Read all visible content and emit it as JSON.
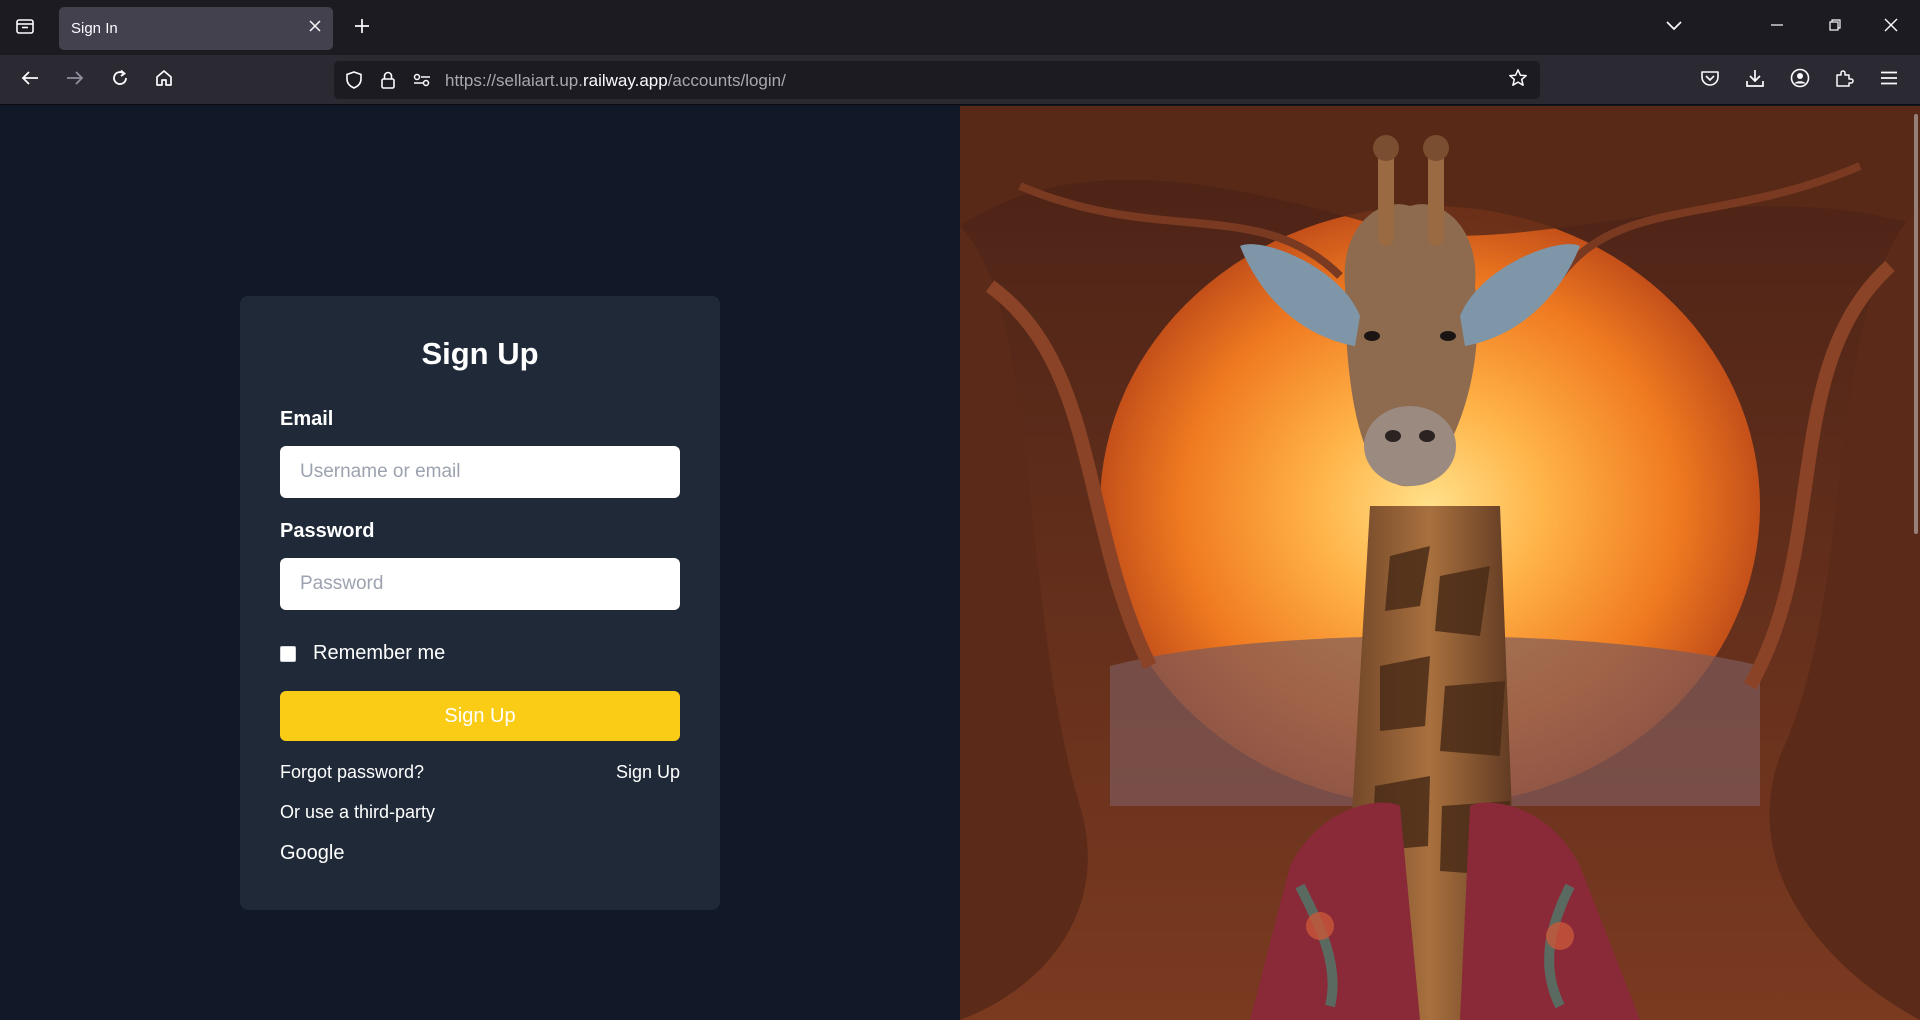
{
  "browser": {
    "tab_title": "Sign In",
    "url_prefix": "https://sellaiart.up.",
    "url_host": "railway.app",
    "url_path": "/accounts/login/"
  },
  "form": {
    "title": "Sign Up",
    "email_label": "Email",
    "email_placeholder": "Username or email",
    "email_value": "",
    "password_label": "Password",
    "password_placeholder": "Password",
    "password_value": "",
    "remember_label": "Remember me",
    "remember_checked": false,
    "submit_label": "Sign Up",
    "forgot_link": "Forgot password?",
    "signup_link": "Sign Up",
    "third_party_text": "Or use a third-party",
    "google_link": "Google"
  },
  "colors": {
    "page_bg": "#111827",
    "card_bg": "#1f2937",
    "accent": "#facc15"
  },
  "icons": [
    "tab-list-icon",
    "close-icon",
    "plus-icon",
    "chevron-down-icon",
    "minimize-icon",
    "restore-icon",
    "back-icon",
    "forward-icon",
    "reload-icon",
    "home-icon",
    "shield-icon",
    "lock-icon",
    "permissions-icon",
    "star-icon",
    "pocket-icon",
    "download-icon",
    "account-icon",
    "extensions-icon",
    "menu-icon"
  ]
}
